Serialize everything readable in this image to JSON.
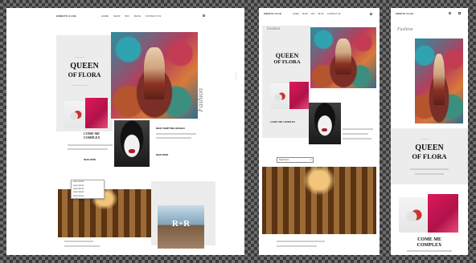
{
  "desktop": {
    "logo": "GREETS CLUB",
    "nav": [
      "HOME",
      "SHOP",
      "BIO",
      "BLOG",
      "CONTACT US"
    ],
    "title_line1": "QUEEN",
    "title_line2": "OF FLORA",
    "side_label": "Fashion",
    "article1": "COME ME COMPLEX",
    "article2": "NEW TEMPTING DESIGN",
    "more": "READ MORE",
    "menu_items": [
      "Lorem ipsum",
      "Lorem ipsum",
      "Lorem ipsum",
      "Lorem ipsum",
      "Lorem ipsum"
    ],
    "overlay_text": "R+R"
  },
  "tablet": {
    "logo": "GREETS CLUB",
    "nav": [
      "HOME",
      "SHOP",
      "BIO",
      "BLOG",
      "CONTACT US"
    ],
    "side_label": "Fashion",
    "title_line1": "QUEEN",
    "title_line2": "OF FLORA",
    "article1": "COME ME COMPLEX",
    "select_value": "Select item"
  },
  "mobile": {
    "logo": "GREETS CLUB",
    "side_label": "Fashion",
    "title_line1": "QUEEN",
    "title_line2": "OF FLORA",
    "article1_line1": "COME ME",
    "article1_line2": "COMPLEX"
  },
  "icons": [
    "search-icon",
    "menu-icon"
  ],
  "colors": {
    "accent_pink": "#e0185a",
    "frame_bg": "#ffffff",
    "checker": "#6e6e6e"
  }
}
